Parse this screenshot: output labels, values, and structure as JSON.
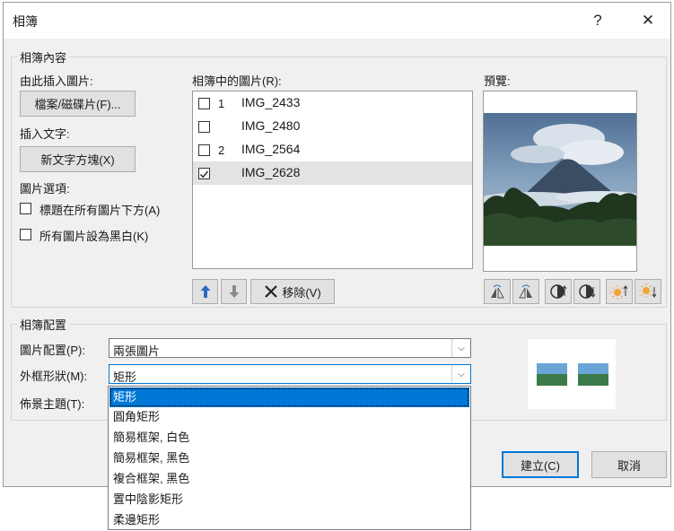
{
  "window": {
    "title": "相簿",
    "help_label": "?",
    "close_label": "✕"
  },
  "content_group": {
    "label": "相簿內容",
    "insert_from_label": "由此插入圖片:",
    "file_button": "檔案/磁碟片(F)...",
    "insert_text_label": "插入文字:",
    "new_textbox_button": "新文字方塊(X)",
    "picture_options_label": "圖片選項:",
    "caption_option": {
      "label": "標題在所有圖片下方(A)",
      "checked": false
    },
    "bw_option": {
      "label": "所有圖片設為黑白(K)",
      "checked": false
    }
  },
  "pictures": {
    "label": "相簿中的圖片(R):",
    "items": [
      {
        "num": "1",
        "name": "IMG_2433",
        "checked": false
      },
      {
        "num": "",
        "name": "IMG_2480",
        "checked": false
      },
      {
        "num": "2",
        "name": "IMG_2564",
        "checked": false
      },
      {
        "num": "",
        "name": "IMG_2628",
        "checked": true
      }
    ],
    "remove_button": "移除(V)"
  },
  "preview": {
    "label": "預覽:"
  },
  "layout_group": {
    "label": "相簿配置",
    "picture_layout_label": "圖片配置(P):",
    "picture_layout_value": "兩張圖片",
    "frame_shape_label": "外框形狀(M):",
    "frame_shape_value": "矩形",
    "theme_label": "佈景主題(T):",
    "frame_options": [
      "矩形",
      "圓角矩形",
      "簡易框架, 白色",
      "簡易框架, 黑色",
      "複合框架, 黑色",
      "置中陰影矩形",
      "柔邊矩形"
    ]
  },
  "buttons": {
    "create": "建立(C)",
    "cancel": "取消"
  },
  "colors": {
    "accent": "#0078d7",
    "arrow_blue": "#2a6cbf"
  }
}
